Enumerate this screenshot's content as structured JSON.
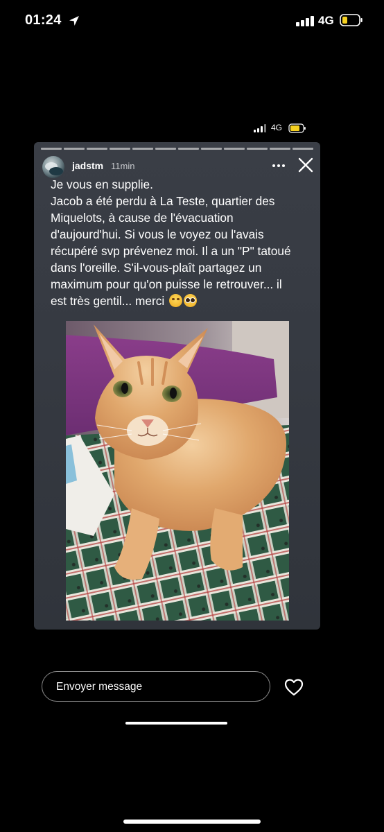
{
  "status_bar": {
    "time": "01:24",
    "network": "4G",
    "icons": [
      "location-arrow-icon",
      "cellular-signal-icon",
      "battery-low-icon"
    ]
  },
  "inner_status_bar": {
    "network": "4G",
    "icons": [
      "cellular-signal-icon",
      "battery-icon"
    ]
  },
  "story": {
    "username": "jadstm",
    "time_ago": "11min",
    "caption_lines": [
      "Je vous en supplie.",
      "Jacob a été perdu à La Teste, quartier des",
      "Miquelots, à cause de l'évacuation",
      "d'aujourd'hui. Si vous le voyez ou l'avais",
      "récupéré svp prévenez moi. Il a un \"P\" tatoué",
      "dans l'oreille. S'il-vous-plaît partagez un",
      "maximum pour qu'on puisse le retrouver... il",
      "est très gentil... merci"
    ],
    "emojis": [
      "pensive-face",
      "pleading-face"
    ],
    "photo_subject": "orange-tabby-cat-on-plaid-tablecloth",
    "icons": [
      "more-options-icon",
      "close-icon"
    ]
  },
  "reply": {
    "placeholder": "Envoyer message",
    "like_icon": "heart-outline-icon"
  },
  "colors": {
    "background": "#000000",
    "card": "#363a42",
    "battery_fill": "#f5d020",
    "text": "#ffffff"
  }
}
